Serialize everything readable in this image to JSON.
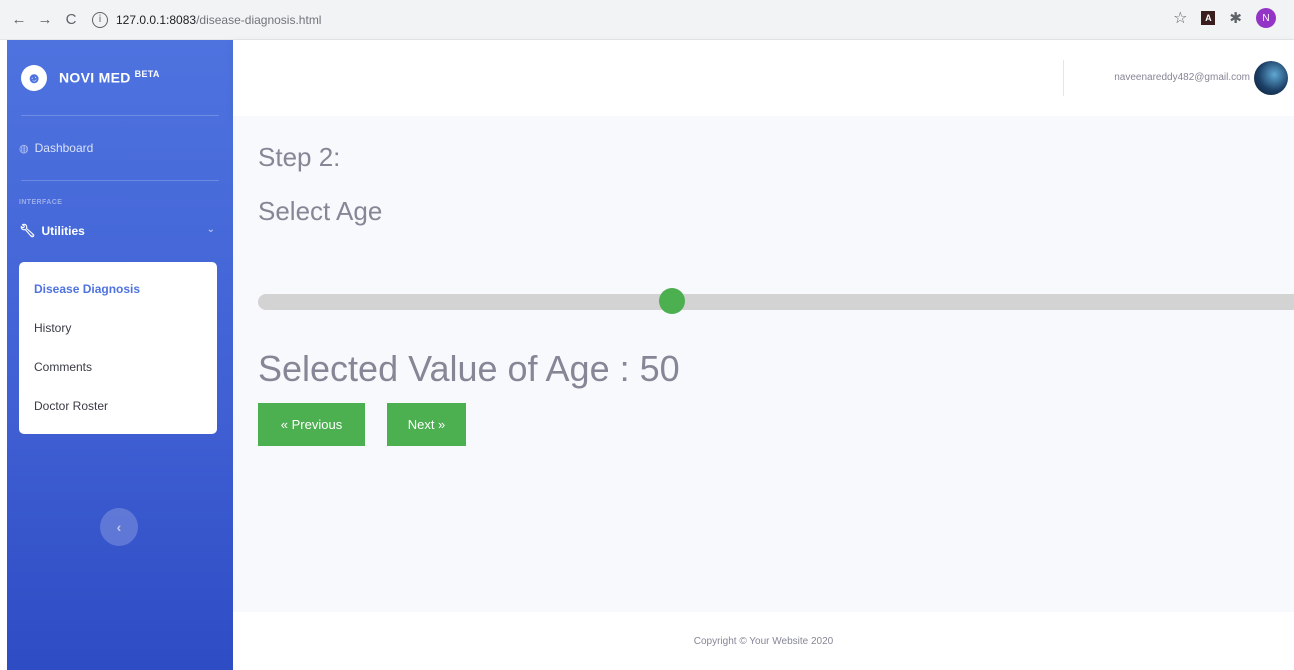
{
  "browser": {
    "back": "←",
    "forward": "→",
    "reload": "C",
    "url_host": "127.0.0.1:8083",
    "url_path": "/disease-diagnosis.html",
    "star": "☆",
    "profile_initial": "N"
  },
  "sidebar": {
    "brand": "NOVI MED",
    "brand_badge": "BETA",
    "dashboard": "Dashboard",
    "heading": "INTERFACE",
    "utilities": "Utilities",
    "items": [
      {
        "label": "Disease Diagnosis"
      },
      {
        "label": "History"
      },
      {
        "label": "Comments"
      },
      {
        "label": "Doctor Roster"
      }
    ],
    "toggle": "‹"
  },
  "topbar": {
    "user_email": "naveenareddy482@gmail.com"
  },
  "main": {
    "step_title": "Step 2:",
    "step_subtitle": "Select Age",
    "slider": {
      "min": 0,
      "max": 125,
      "value": 50
    },
    "selected_label": "Selected Value of Age : 50",
    "prev_button": "« Previous",
    "next_button": "Next »"
  },
  "footer": {
    "copyright": "Copyright © Your Website 2020"
  },
  "colors": {
    "sidebar": "#4e73df",
    "accent_green": "#4caf50",
    "text_gray": "#858796"
  }
}
